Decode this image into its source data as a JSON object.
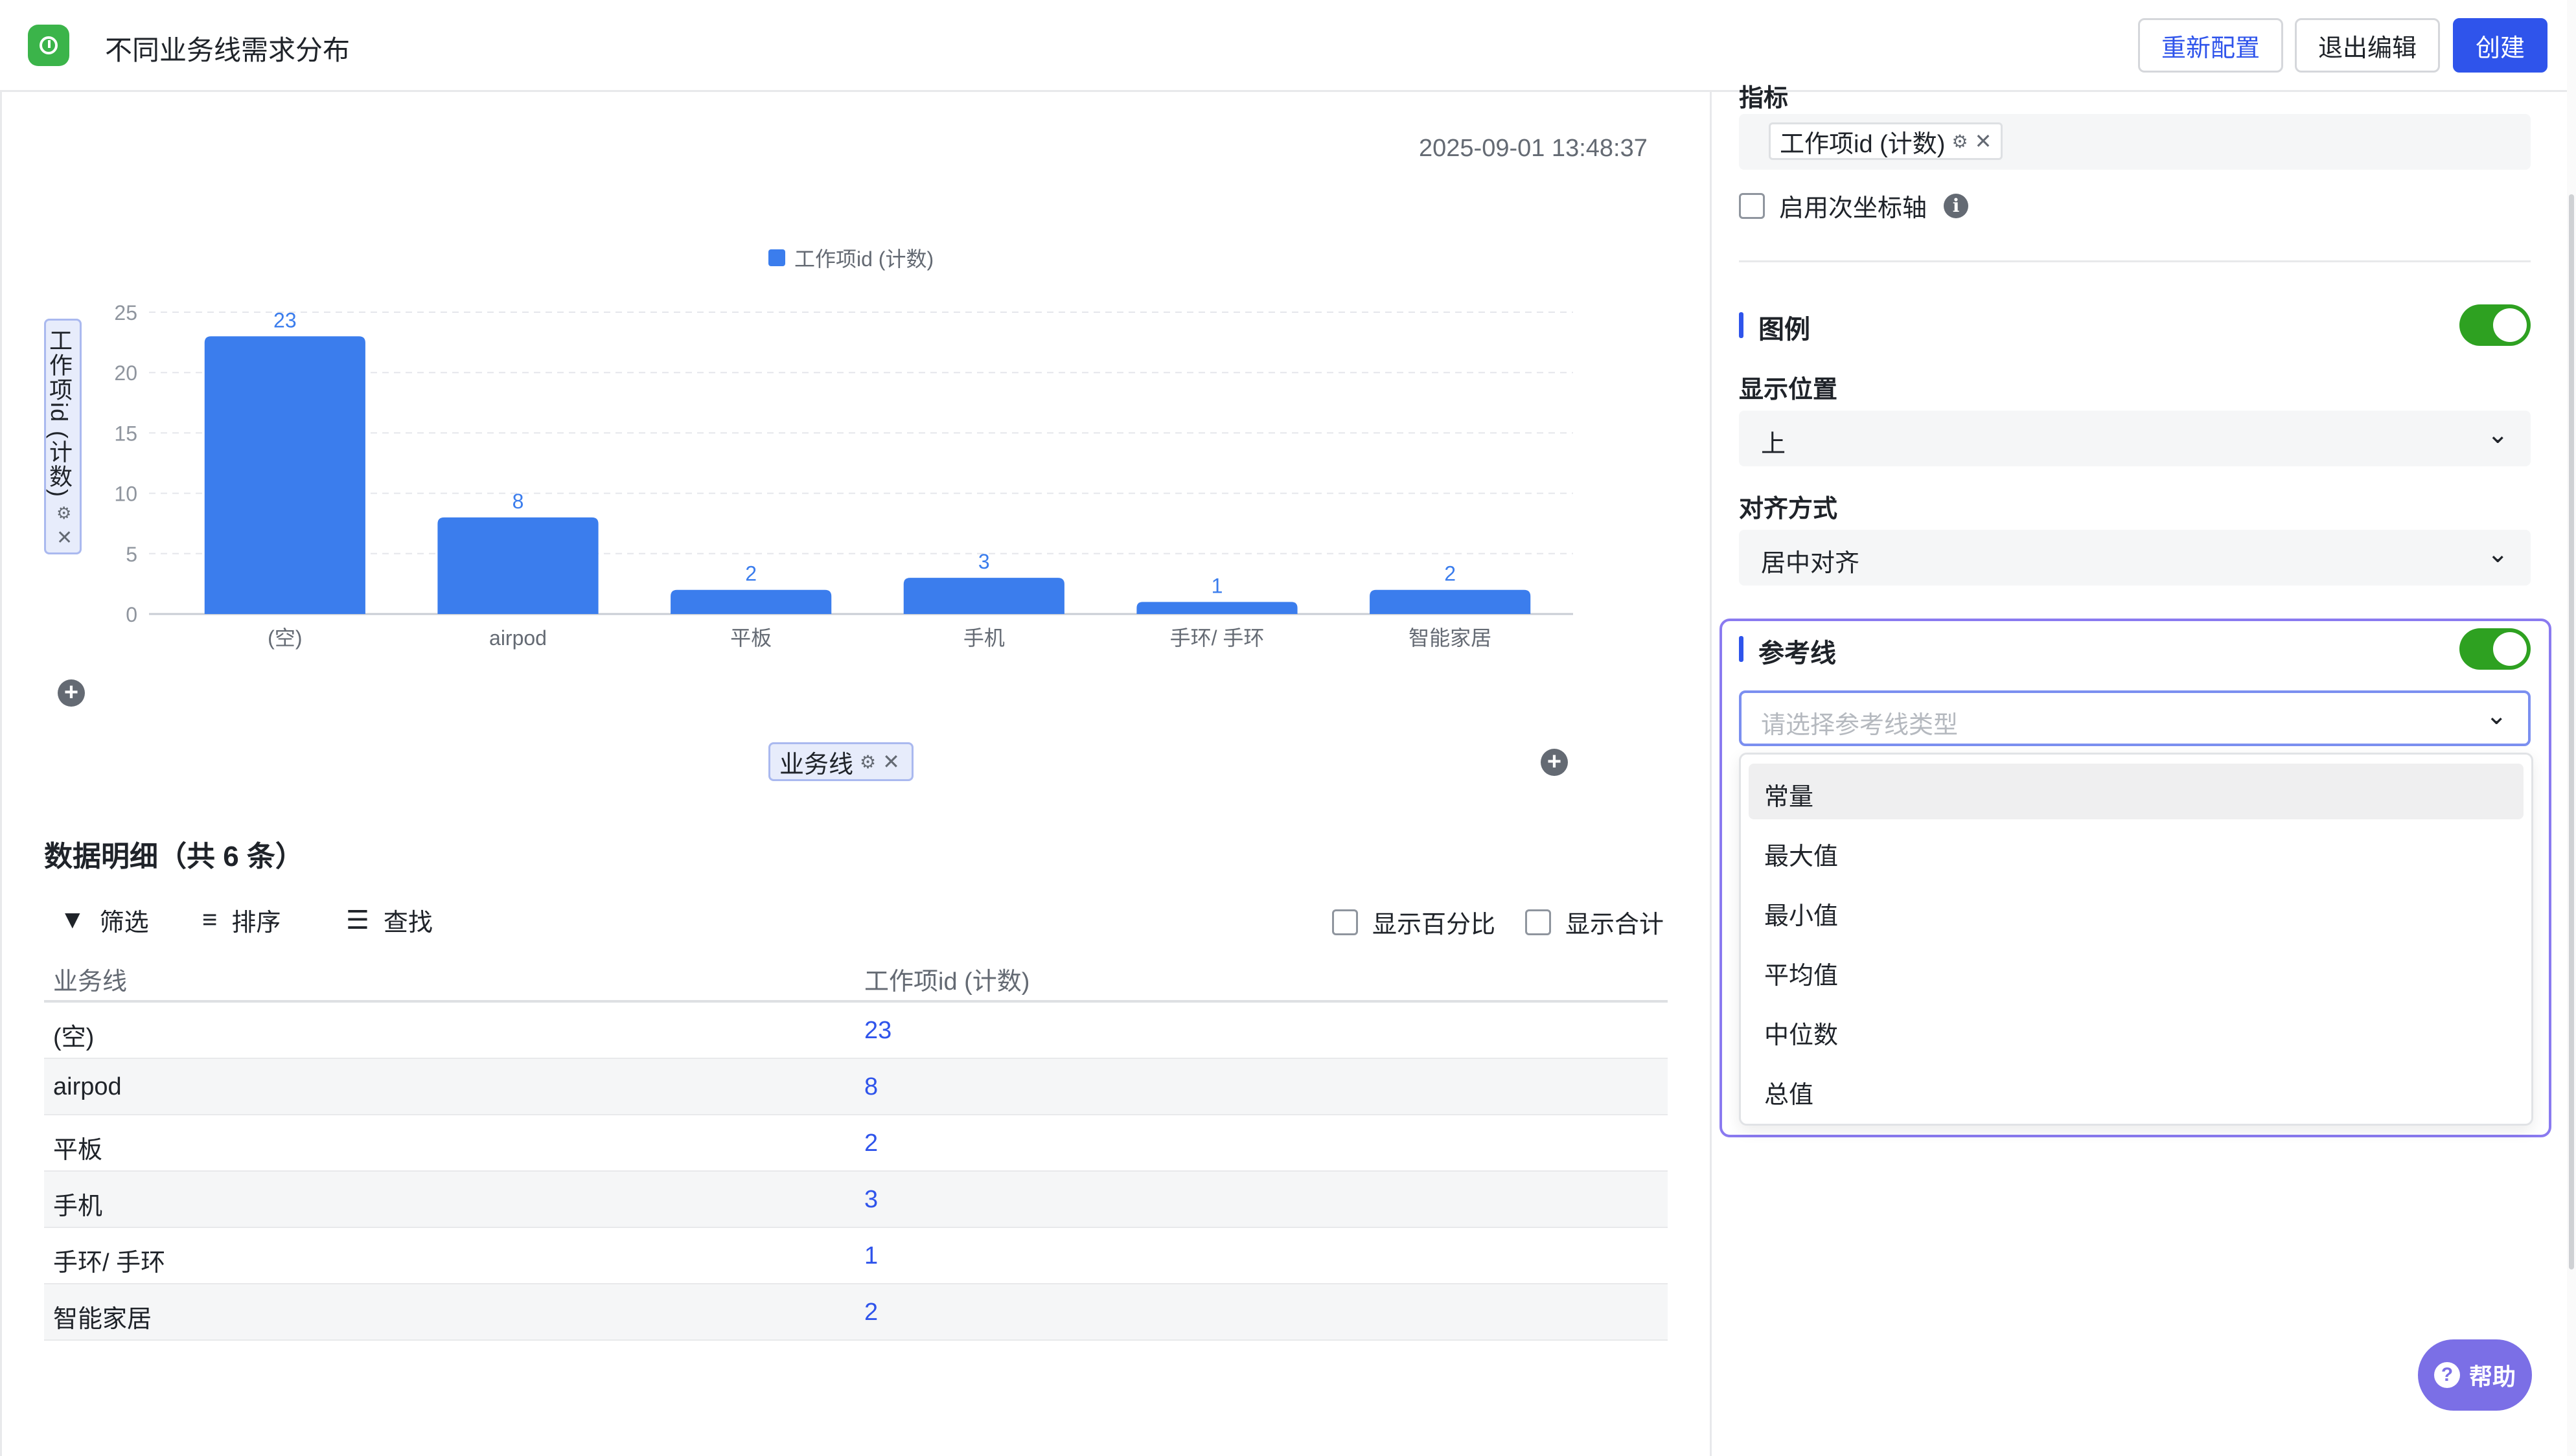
{
  "header": {
    "title": "不同业务线需求分布",
    "buttons": {
      "reconfig": "重新配置",
      "exit": "退出编辑",
      "create": "创建"
    }
  },
  "chart_panel": {
    "timestamp": "2025-09-01 13:48:37",
    "y_field": "工作项id (计数)",
    "x_field": "业务线"
  },
  "chart_data": {
    "type": "bar",
    "categories": [
      "(空)",
      "airpod",
      "平板",
      "手机",
      "手环/ 手环",
      "智能家居"
    ],
    "series": [
      {
        "name": "工作项id (计数)",
        "values": [
          23,
          8,
          2,
          3,
          1,
          2
        ]
      }
    ],
    "ylim": [
      0,
      25
    ],
    "yticks": [
      0,
      5,
      10,
      15,
      20,
      25
    ],
    "ylabel": "工作项id (计数)",
    "xlabel": "业务线",
    "legend_position": "top-center",
    "data_labels": true,
    "grid": true,
    "bar_color": "#3b7ded"
  },
  "detail": {
    "title": "数据明细（共 6 条）",
    "tools": {
      "filter": "筛选",
      "sort": "排序",
      "find": "查找"
    },
    "checks": {
      "percent": "显示百分比",
      "total": "显示合计"
    },
    "columns": [
      "业务线",
      "工作项id (计数)"
    ],
    "rows": [
      [
        "(空)",
        "23"
      ],
      [
        "airpod",
        "8"
      ],
      [
        "平板",
        "2"
      ],
      [
        "手机",
        "3"
      ],
      [
        "手环/ 手环",
        "1"
      ],
      [
        "智能家居",
        "2"
      ]
    ]
  },
  "settings": {
    "metric_label": "指标",
    "metric_tag": "工作项id (计数)",
    "secondary_axis": "启用次坐标轴",
    "legend_section": "图例",
    "legend_enabled": true,
    "position_label": "显示位置",
    "position_value": "上",
    "align_label": "对齐方式",
    "align_value": "居中对齐",
    "refline_section": "参考线",
    "refline_enabled": true,
    "refline_placeholder": "请选择参考线类型",
    "refline_options": [
      "常量",
      "最大值",
      "最小值",
      "平均值",
      "中位数",
      "总值"
    ]
  },
  "help": "帮助",
  "colors": {
    "accent": "#2f54eb",
    "toggle_on": "#2ea121",
    "bar": "#3b7ded",
    "help": "#7b6fe6"
  }
}
